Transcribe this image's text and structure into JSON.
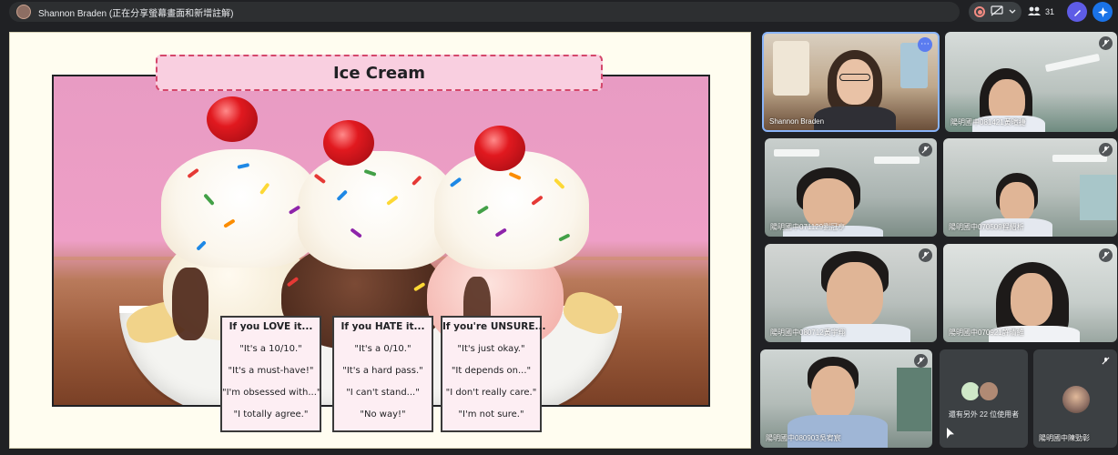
{
  "meeting": {
    "presenter_status": "Shannon Braden (正在分享螢幕畫面和新增註解)",
    "participant_count": "31"
  },
  "slide": {
    "title": "Ice Cream",
    "cards": [
      {
        "heading": "If you LOVE it...",
        "lines": [
          "\"It's a 10/10.\"",
          "\"It's a must-have!\"",
          "\"I'm obsessed with...\"",
          "\"I totally agree.\""
        ]
      },
      {
        "heading": "If you HATE it...",
        "lines": [
          "\"It's a 0/10.\"",
          "\"It's a hard pass.\"",
          "\"I can't stand...\"",
          "\"No way!\""
        ]
      },
      {
        "heading": "If you're UNSURE...",
        "lines": [
          "\"It's just okay.\"",
          "\"It depends on...\"",
          "\"I don't really care.\"",
          "\"I'm not sure.\""
        ]
      }
    ]
  },
  "participants": [
    {
      "name": "Shannon Braden"
    },
    {
      "name": "陽明國中081421黃暄捷"
    },
    {
      "name": "陽明國中071129劉冠亨"
    },
    {
      "name": "陽明國中070509程紹析"
    },
    {
      "name": "陽明國中080712黃宇翔"
    },
    {
      "name": "陽明國中070921許清維"
    },
    {
      "name": "陽明國中080903吳宥宸"
    },
    {
      "name": "陽明國中陳勁彰"
    }
  ],
  "others_tile": {
    "label": "還有另外 22 位使用者"
  },
  "colors": {
    "accent_blue": "#8ab4f8",
    "record_red": "#f28b82",
    "stage_bg": "#fffdf0",
    "banner_pink": "#f9cfe0"
  }
}
